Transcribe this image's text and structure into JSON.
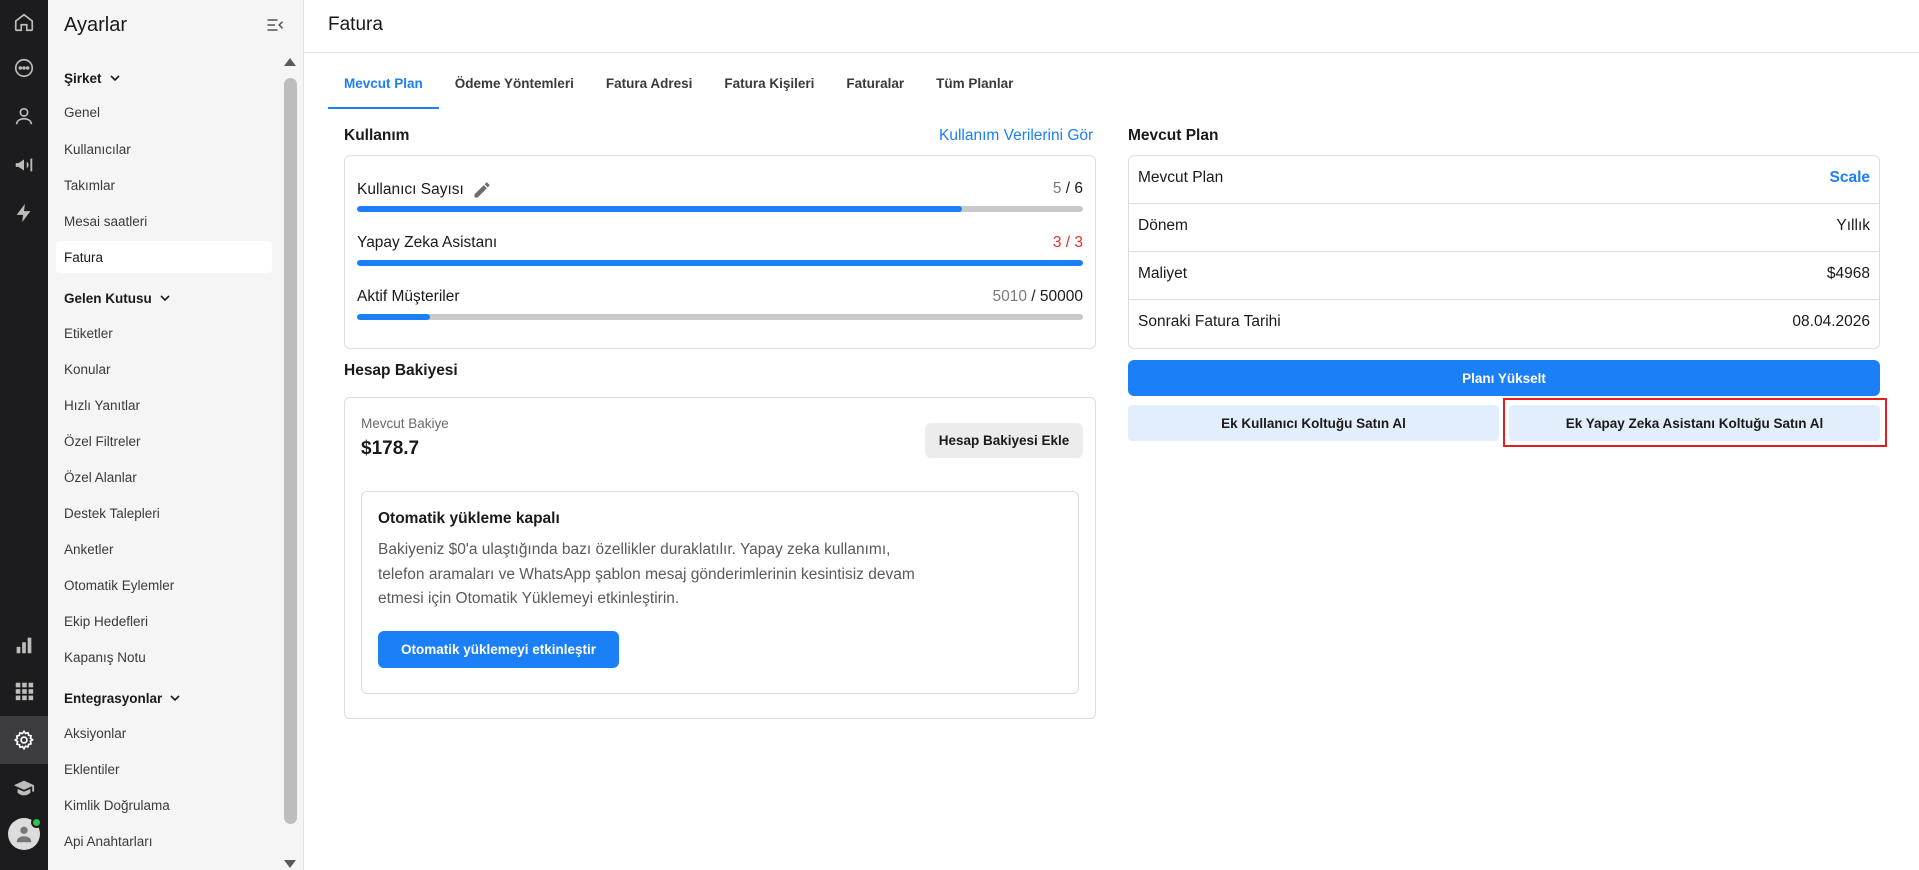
{
  "sidebar": {
    "title": "Ayarlar",
    "groups": [
      {
        "label": "Şirket",
        "items": [
          "Genel",
          "Kullanıcılar",
          "Takımlar",
          "Mesai saatleri",
          "Fatura"
        ]
      },
      {
        "label": "Gelen Kutusu",
        "items": [
          "Etiketler",
          "Konular",
          "Hızlı Yanıtlar",
          "Özel Filtreler",
          "Özel Alanlar",
          "Destek Talepleri",
          "Anketler",
          "Otomatik Eylemler",
          "Ekip Hedefleri",
          "Kapanış Notu"
        ]
      },
      {
        "label": "Entegrasyonlar",
        "items": [
          "Aksiyonlar",
          "Eklentiler",
          "Kimlik Doğrulama",
          "Api Anahtarları"
        ]
      }
    ],
    "active_item": "Fatura"
  },
  "page": {
    "title": "Fatura"
  },
  "tabs": [
    "Mevcut Plan",
    "Ödeme Yöntemleri",
    "Fatura Adresi",
    "Fatura Kişileri",
    "Faturalar",
    "Tüm Planlar"
  ],
  "usage": {
    "title": "Kullanım",
    "link": "Kullanım Verilerini Gör",
    "rows": [
      {
        "label": "Kullanıcı Sayısı",
        "used": "5",
        "sep": " / ",
        "total": "6",
        "fraction": 0.833,
        "editable": true,
        "over_limit": false
      },
      {
        "label": "Yapay Zeka Asistanı",
        "used": "3",
        "sep": " / ",
        "total": "3",
        "fraction": 1.0,
        "editable": false,
        "over_limit": true
      },
      {
        "label": "Aktif Müşteriler",
        "used": "5010",
        "sep": " / ",
        "total": "50000",
        "fraction": 0.1,
        "editable": false,
        "over_limit": false
      }
    ]
  },
  "balance": {
    "title": "Hesap Bakiyesi",
    "current_label": "Mevcut Bakiye",
    "current_value": "$178.7",
    "add_button": "Hesap Bakiyesi Ekle",
    "auto_title": "Otomatik yükleme kapalı",
    "auto_desc": "Bakiyeniz $0'a ulaştığında bazı özellikler duraklatılır. Yapay zeka kullanımı, telefon aramaları ve WhatsApp şablon mesaj gönderimlerinin kesintisiz devam etmesi için Otomatik Yüklemeyi etkinleştirin.",
    "auto_button": "Otomatik yüklemeyi etkinleştir"
  },
  "plan": {
    "title": "Mevcut Plan",
    "rows": [
      {
        "key": "Mevcut Plan",
        "value": "Scale",
        "accent": true
      },
      {
        "key": "Dönem",
        "value": "Yıllık",
        "accent": false
      },
      {
        "key": "Maliyet",
        "value": "$4968",
        "accent": false
      },
      {
        "key": "Sonraki Fatura Tarihi",
        "value": "08.04.2026",
        "accent": false
      }
    ],
    "upgrade_button": "Planı Yükselt",
    "buy_user_seat": "Ek Kullanıcı Koltuğu Satın Al",
    "buy_ai_seat": "Ek Yapay Zeka Asistanı Koltuğu Satın Al"
  },
  "colors": {
    "accent": "#1b7ff5",
    "danger": "#e03030",
    "highlight": "#e02020",
    "rail": "#1c1c1e"
  }
}
